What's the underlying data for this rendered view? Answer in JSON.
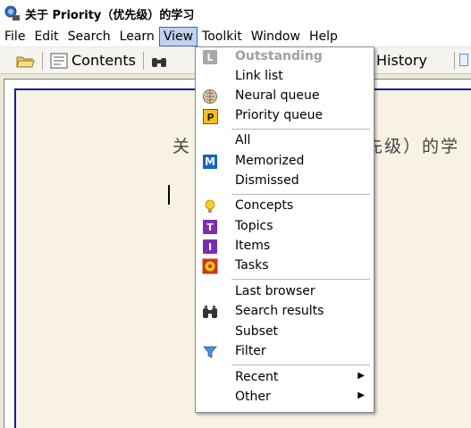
{
  "window": {
    "title": "关于 Priority（优先级）的学习"
  },
  "menubar": {
    "items": [
      "File",
      "Edit",
      "Search",
      "Learn",
      "View",
      "Toolkit",
      "Window",
      "Help"
    ]
  },
  "toolbar": {
    "contents_label": "Contents",
    "history_label": "History"
  },
  "editor": {
    "heading_left": "关",
    "heading_right": "先级）的学"
  },
  "view_menu": {
    "items": [
      {
        "label": "Outstanding",
        "icon": "outstanding-L-icon",
        "disabled": true
      },
      {
        "label": "Link list",
        "icon": null
      },
      {
        "label": "Neural queue",
        "icon": "brain-icon"
      },
      {
        "label": "Priority queue",
        "icon": "priority-icon"
      },
      {
        "label": "All",
        "icon": null
      },
      {
        "label": "Memorized",
        "icon": "memorized-M-icon"
      },
      {
        "label": "Dismissed",
        "icon": null
      },
      {
        "label": "Concepts",
        "icon": "lightbulb-icon"
      },
      {
        "label": "Topics",
        "icon": "topic-T-icon"
      },
      {
        "label": "Items",
        "icon": "item-I-icon"
      },
      {
        "label": "Tasks",
        "icon": "task-flower-icon"
      },
      {
        "label": "Last browser",
        "icon": null
      },
      {
        "label": "Search results",
        "icon": "binoculars-icon"
      },
      {
        "label": "Subset",
        "icon": null
      },
      {
        "label": "Filter",
        "icon": "filter-funnel-icon"
      },
      {
        "label": "Recent",
        "icon": null,
        "submenu": true
      },
      {
        "label": "Other",
        "icon": null,
        "submenu": true
      }
    ]
  },
  "colors": {
    "menu_highlight": "#c1d2ee",
    "editor_border": "#1a1aa6",
    "editor_bg": "#f7f2e4",
    "topic_purple": "#7a2fb0",
    "memorized_blue": "#1860c8"
  }
}
